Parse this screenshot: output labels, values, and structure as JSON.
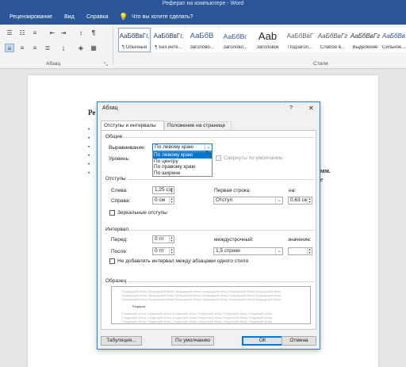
{
  "window": {
    "title": "Реферат на компьютере  -  Word"
  },
  "menu": {
    "items": [
      "Рецензирование",
      "Вид",
      "Справка"
    ],
    "tellme": "Что вы хотите сделать?"
  },
  "ribbon": {
    "paragraph_group_label": "Абзац",
    "styles_group_label": "Стили",
    "styles": [
      {
        "sample": "АаБбВвГг,",
        "name": "¶ Обычный"
      },
      {
        "sample": "АаБбВвГг,",
        "name": "¶ Без инте..."
      },
      {
        "sample": "АаБбВ",
        "name": "Заголово..."
      },
      {
        "sample": "АаБбВг",
        "name": "Заголово..."
      },
      {
        "sample": "Aab",
        "name": "Заголовок"
      },
      {
        "sample": "АаБбВвГ",
        "name": "Подзагол..."
      },
      {
        "sample": "АаБбВвГг",
        "name": "Слабое в..."
      },
      {
        "sample": "АаБбВвГг",
        "name": "Выделение"
      },
      {
        "sample": "АаБбВвГг",
        "name": "Сильное..."
      }
    ]
  },
  "document": {
    "heading": "Ре",
    "side_text": "мм.",
    "side_text2": "е"
  },
  "dialog": {
    "title": "Абзац",
    "help": "?",
    "close": "✕",
    "tabs": [
      "Отступы и интервалы",
      "Положение на странице"
    ],
    "general": {
      "section": "Общие",
      "alignment_label": "Выравнивание:",
      "alignment_value": "По левому краю",
      "alignment_options": [
        "По левому краю",
        "По центру",
        "По правому краю",
        "По ширине"
      ],
      "level_label": "Уровень:",
      "collapsed_label": "Свернуты по умолчанию"
    },
    "indents": {
      "section": "Отступы",
      "left_label": "Слева:",
      "left_value": "1,25 см",
      "right_label": "Справа:",
      "right_value": "0 см",
      "first_line_label": "Первая строка:",
      "first_line_value": "Отступ",
      "by_label": "на:",
      "by_value": "0,63 см",
      "mirror_label": "Зеркальные отступы"
    },
    "spacing": {
      "section": "Интервал",
      "before_label": "Перед:",
      "before_value": "0 пт",
      "after_label": "После:",
      "after_value": "0 пт",
      "line_label": "междустрочный:",
      "line_value": "1,5 строки",
      "at_label": "значение:",
      "at_value": "",
      "no_space_label": "Не добавлять интервал между абзацами одного стиля"
    },
    "preview": {
      "section": "Образец",
      "prev_text": "Предыдущий абзац Предыдущий абзац Предыдущий абзац Предыдущий абзац Предыдущий абзац Предыдущий абзац",
      "sample": "Реферат",
      "next_text": "Следующий абзац Следующий абзац Следующий абзац Следующий абзац Следующий абзац Следующий абзац"
    },
    "buttons": {
      "tabs": "Табуляция...",
      "default": "По умолчанию",
      "ok": "ОК",
      "cancel": "Отмена"
    }
  }
}
